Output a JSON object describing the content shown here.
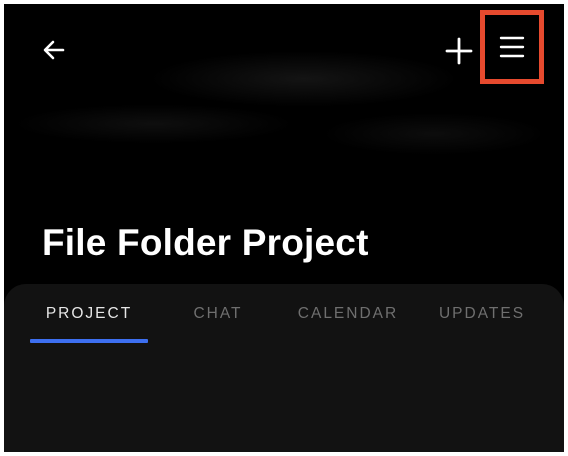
{
  "header": {
    "back_icon": "arrow-left-icon",
    "add_icon": "plus-icon",
    "menu_icon": "hamburger-menu-icon"
  },
  "project": {
    "title": "File Folder Project"
  },
  "tabs": [
    {
      "label": "PROJECT",
      "active": true
    },
    {
      "label": "CHAT",
      "active": false
    },
    {
      "label": "CALENDAR",
      "active": false
    },
    {
      "label": "UPDATES",
      "active": false
    }
  ],
  "colors": {
    "background": "#000000",
    "panel": "#121212",
    "accent": "#3d6ff0",
    "highlight_box": "#e64a2e",
    "active_tab_text": "#e6e6e6",
    "inactive_tab_text": "#6f6f6f"
  }
}
